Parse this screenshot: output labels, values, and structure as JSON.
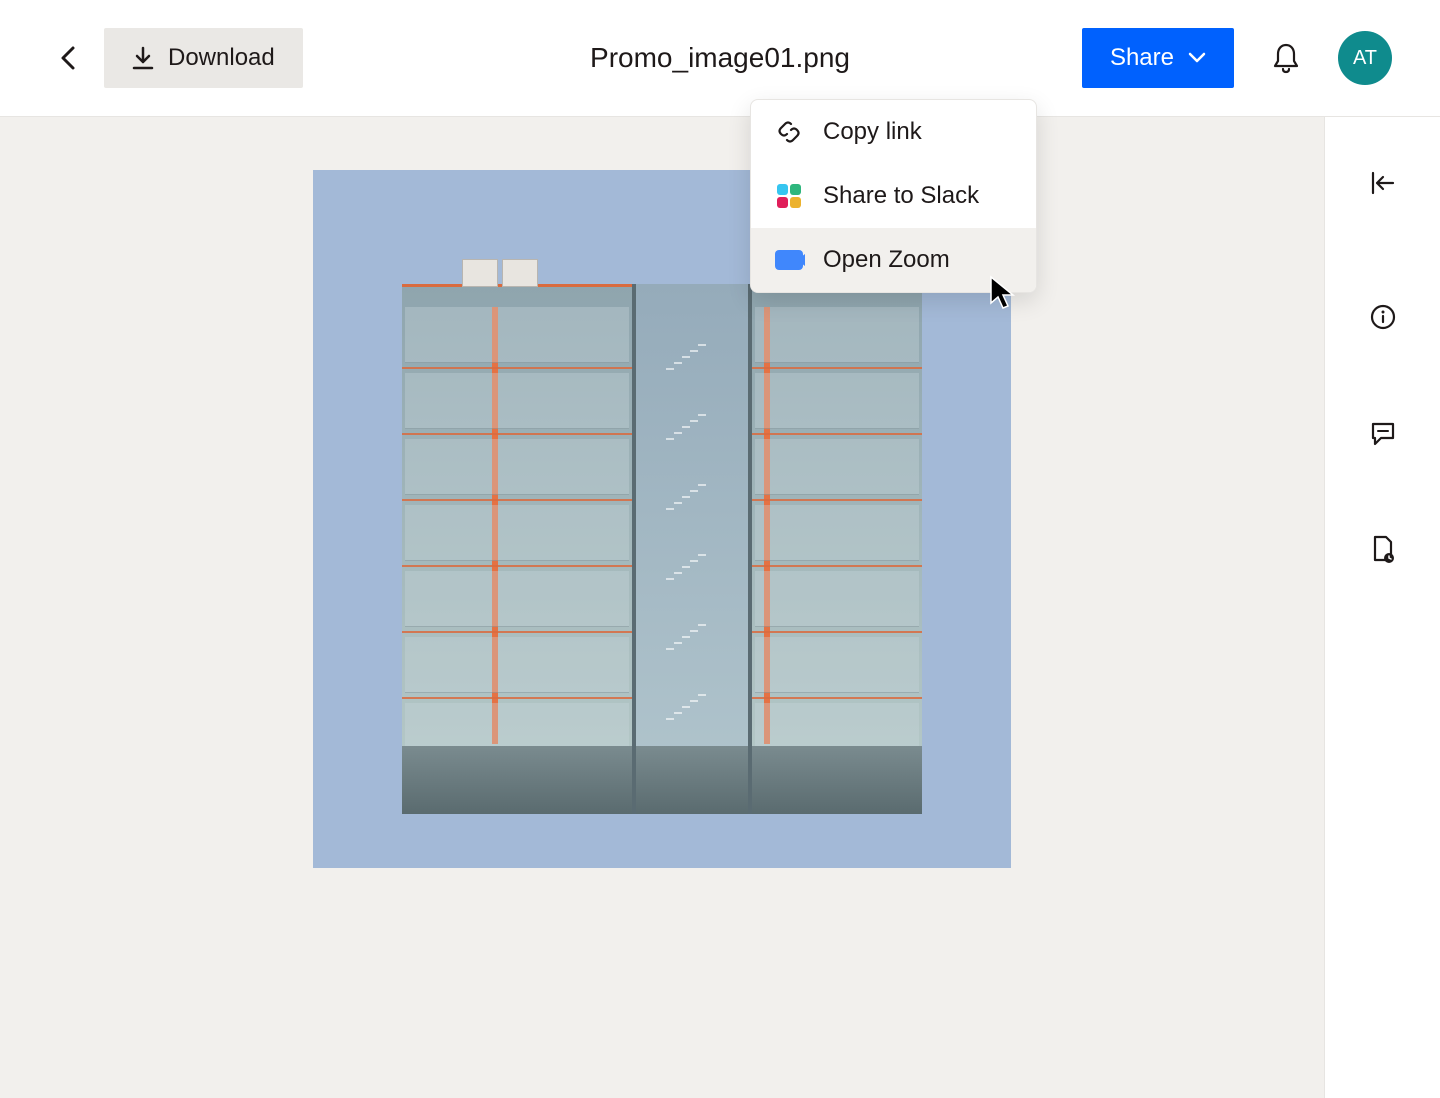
{
  "header": {
    "download_label": "Download",
    "file_title": "Promo_image01.png",
    "share_label": "Share",
    "avatar_initials": "AT"
  },
  "dropdown": {
    "items": [
      {
        "label": "Copy link",
        "icon": "link-icon"
      },
      {
        "label": "Share to Slack",
        "icon": "slack-icon"
      },
      {
        "label": "Open Zoom",
        "icon": "zoom-icon"
      }
    ],
    "hovered_index": 2
  },
  "side_panel": {
    "icons": [
      "collapse-icon",
      "info-icon",
      "comment-icon",
      "file-activity-icon"
    ]
  },
  "colors": {
    "primary": "#0061fe",
    "avatar": "#0f8b8d",
    "canvas": "#f2f0ed",
    "preview_bg": "#a3b9d7"
  }
}
